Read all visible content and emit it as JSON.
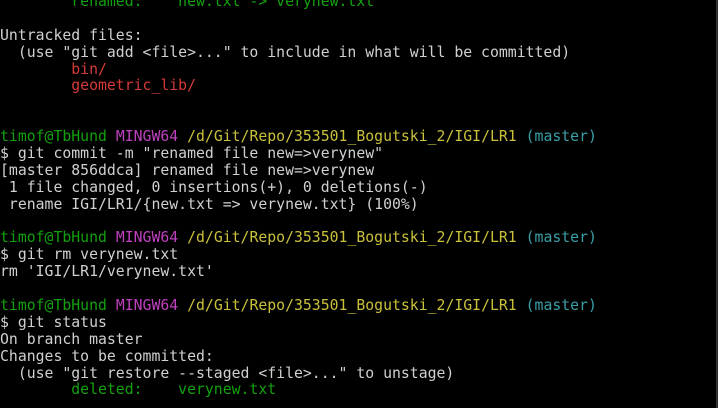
{
  "colors": {
    "background": "#000000",
    "text": "#cccccc",
    "green": "#13a10e",
    "red": "#d53a3a",
    "magenta": "#c040c0",
    "yellow": "#c9c13a",
    "cyan": "#3aa0a8"
  },
  "lines": [
    [
      {
        "t": "        renamed:    new.txt -> verynew.txt",
        "c": "green"
      }
    ],
    [],
    [
      {
        "t": "Untracked files:",
        "c": "white"
      }
    ],
    [
      {
        "t": "  (use \"git add <file>...\" to include in what will be committed)",
        "c": "white"
      }
    ],
    [
      {
        "t": "        bin/",
        "c": "red"
      }
    ],
    [
      {
        "t": "        geometric_lib/",
        "c": "red"
      }
    ],
    [],
    [],
    [
      {
        "t": "timof@TbHund ",
        "c": "green"
      },
      {
        "t": "MINGW64 ",
        "c": "magenta"
      },
      {
        "t": "/d/Git/Repo/353501_Bogutski_2/IGI/LR1",
        "c": "yellow"
      },
      {
        "t": " (master)",
        "c": "cyan"
      }
    ],
    [
      {
        "t": "$ git commit -m \"renamed file new=>verynew\"",
        "c": "white"
      }
    ],
    [
      {
        "t": "[master 856ddca] renamed file new=>verynew",
        "c": "white"
      }
    ],
    [
      {
        "t": " 1 file changed, 0 insertions(+), 0 deletions(-)",
        "c": "white"
      }
    ],
    [
      {
        "t": " rename IGI/LR1/{new.txt => verynew.txt} (100%)",
        "c": "white"
      }
    ],
    [],
    [
      {
        "t": "timof@TbHund ",
        "c": "green"
      },
      {
        "t": "MINGW64 ",
        "c": "magenta"
      },
      {
        "t": "/d/Git/Repo/353501_Bogutski_2/IGI/LR1",
        "c": "yellow"
      },
      {
        "t": " (master)",
        "c": "cyan"
      }
    ],
    [
      {
        "t": "$ git rm verynew.txt",
        "c": "white"
      }
    ],
    [
      {
        "t": "rm 'IGI/LR1/verynew.txt'",
        "c": "white"
      }
    ],
    [],
    [
      {
        "t": "timof@TbHund ",
        "c": "green"
      },
      {
        "t": "MINGW64 ",
        "c": "magenta"
      },
      {
        "t": "/d/Git/Repo/353501_Bogutski_2/IGI/LR1",
        "c": "yellow"
      },
      {
        "t": " (master)",
        "c": "cyan"
      }
    ],
    [
      {
        "t": "$ git status",
        "c": "white"
      }
    ],
    [
      {
        "t": "On branch master",
        "c": "white"
      }
    ],
    [
      {
        "t": "Changes to be committed:",
        "c": "white"
      }
    ],
    [
      {
        "t": "  (use \"git restore --staged <file>...\" to unstage)",
        "c": "white"
      }
    ],
    [
      {
        "t": "        deleted:    verynew.txt",
        "c": "green"
      }
    ]
  ]
}
